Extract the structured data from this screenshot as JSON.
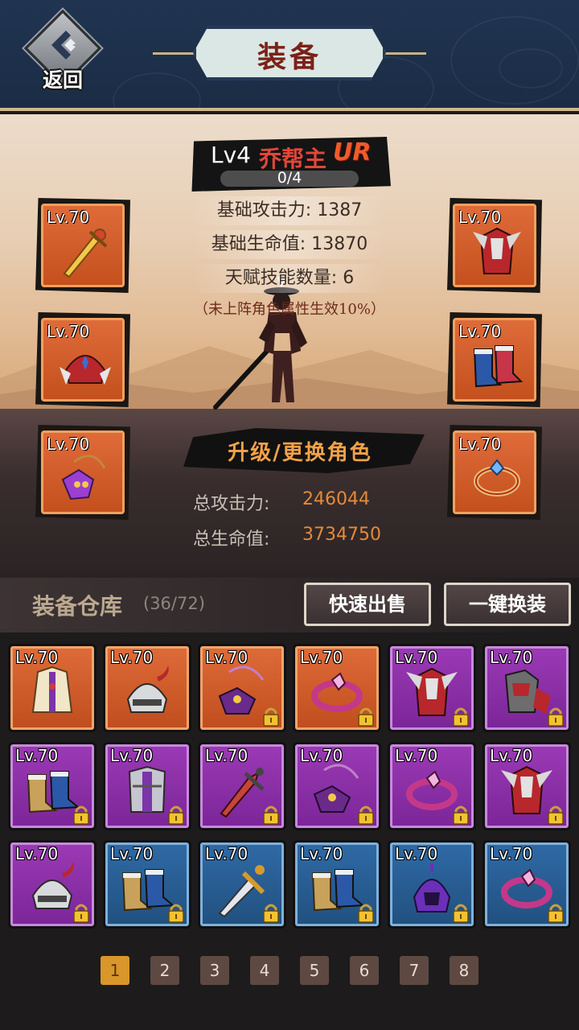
{
  "header": {
    "back_label": "返回",
    "title": "装备"
  },
  "hero": {
    "level": "Lv4",
    "name": "乔帮主",
    "rarity": "UR",
    "exp": "0/4",
    "stats": [
      "基础攻击力: 1387",
      "基础生命值: 13870",
      "天赋技能数量: 6"
    ],
    "note": "（未上阵角色属性生效10%）",
    "upgrade_label": "升级/更换角色",
    "total_attack_label": "总攻击力:",
    "total_attack_value": "246044",
    "total_hp_label": "总生命值:",
    "total_hp_value": "3734750"
  },
  "equipped": {
    "left": [
      {
        "level": "Lv.70",
        "icon": "sword-icon"
      },
      {
        "level": "Lv.70",
        "icon": "helmet-icon"
      },
      {
        "level": "Lv.70",
        "icon": "amulet-icon"
      }
    ],
    "right": [
      {
        "level": "Lv.70",
        "icon": "armor-icon"
      },
      {
        "level": "Lv.70",
        "icon": "boots-icon"
      },
      {
        "level": "Lv.70",
        "icon": "ring-icon"
      }
    ]
  },
  "warehouse": {
    "title": "装备仓库",
    "count": "(36/72)",
    "quick_sell_label": "快速出售",
    "equip_all_label": "一键换装",
    "items": [
      {
        "level": "Lv.70",
        "rarity": "orange",
        "icon": "robe-icon",
        "locked": false
      },
      {
        "level": "Lv.70",
        "rarity": "orange",
        "icon": "horned-helmet-icon",
        "locked": false
      },
      {
        "level": "Lv.70",
        "rarity": "orange",
        "icon": "amulet-icon",
        "locked": true
      },
      {
        "level": "Lv.70",
        "rarity": "orange",
        "icon": "ring-icon",
        "locked": true
      },
      {
        "level": "Lv.70",
        "rarity": "purple",
        "icon": "armor-icon",
        "locked": true
      },
      {
        "level": "Lv.70",
        "rarity": "purple",
        "icon": "plate-armor-icon",
        "locked": true
      },
      {
        "level": "Lv.70",
        "rarity": "purple",
        "icon": "boots-icon",
        "locked": true
      },
      {
        "level": "Lv.70",
        "rarity": "purple",
        "icon": "chest-armor-icon",
        "locked": true
      },
      {
        "level": "Lv.70",
        "rarity": "purple",
        "icon": "sword-icon",
        "locked": true
      },
      {
        "level": "Lv.70",
        "rarity": "purple",
        "icon": "amulet-icon",
        "locked": true
      },
      {
        "level": "Lv.70",
        "rarity": "purple",
        "icon": "ring-icon",
        "locked": true
      },
      {
        "level": "Lv.70",
        "rarity": "purple",
        "icon": "armor-icon",
        "locked": true
      },
      {
        "level": "Lv.70",
        "rarity": "purple",
        "icon": "horned-helmet-icon",
        "locked": true
      },
      {
        "level": "Lv.70",
        "rarity": "blue",
        "icon": "boots-icon",
        "locked": true
      },
      {
        "level": "Lv.70",
        "rarity": "blue",
        "icon": "dagger-icon",
        "locked": true
      },
      {
        "level": "Lv.70",
        "rarity": "blue",
        "icon": "boots-icon",
        "locked": true
      },
      {
        "level": "Lv.70",
        "rarity": "blue",
        "icon": "helmet-icon",
        "locked": true
      },
      {
        "level": "Lv.70",
        "rarity": "blue",
        "icon": "ring-icon",
        "locked": true
      }
    ]
  },
  "pagination": {
    "pages": [
      "1",
      "2",
      "3",
      "4",
      "5",
      "6",
      "7",
      "8"
    ],
    "current": "1"
  }
}
